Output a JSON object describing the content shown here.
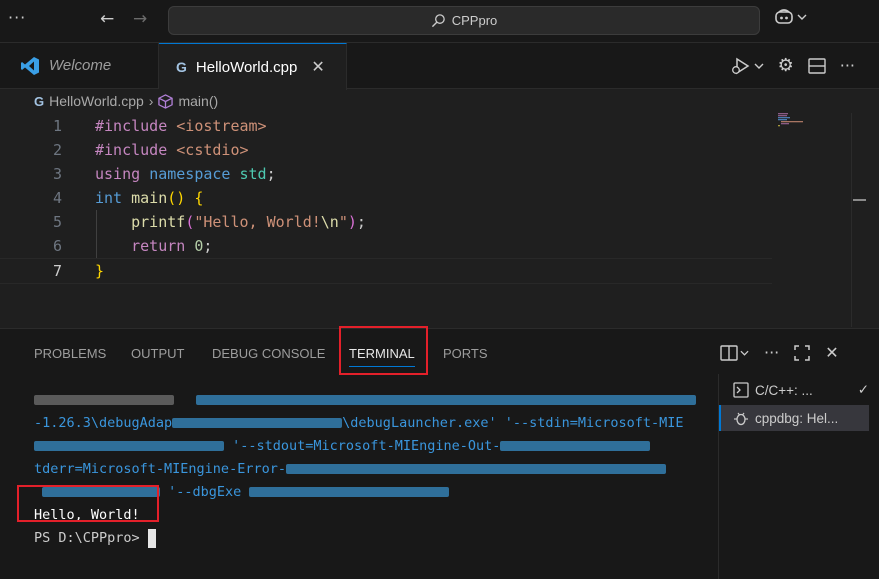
{
  "window": {
    "search_text": "CPPpro"
  },
  "tabs": [
    {
      "label": "Welcome"
    },
    {
      "label": "HelloWorld.cpp"
    }
  ],
  "breadcrumb": {
    "file": "HelloWorld.cpp",
    "symbol": "main()"
  },
  "editor": {
    "line_numbers": [
      "1",
      "2",
      "3",
      "4",
      "5",
      "6",
      "7"
    ]
  },
  "panel": {
    "tabs": [
      "PROBLEMS",
      "OUTPUT",
      "DEBUG CONSOLE",
      "TERMINAL",
      "PORTS"
    ],
    "active_tab": "TERMINAL",
    "terminal": {
      "line2_visible": "-1.26.3\\debugAdap",
      "line2_visible_b": "\\debugLauncher.exe' '--stdin=Microsoft-MIE",
      "line3_visible": "'--stdout=Microsoft-MIEngine-Out-",
      "line4_visible": "tderr=Microsoft-MIEngine-Error-",
      "line5_visible": "'--dbgExe",
      "output": "Hello, World!",
      "prompt": "PS D:\\CPPpro>"
    },
    "instances": [
      {
        "label": "C/C++: ..."
      },
      {
        "label": "cppdbg: Hel..."
      }
    ]
  },
  "colors": {
    "accent": "#0078d4",
    "highlight_box": "#e3202a",
    "terminal_blue": "#3a96dd"
  }
}
